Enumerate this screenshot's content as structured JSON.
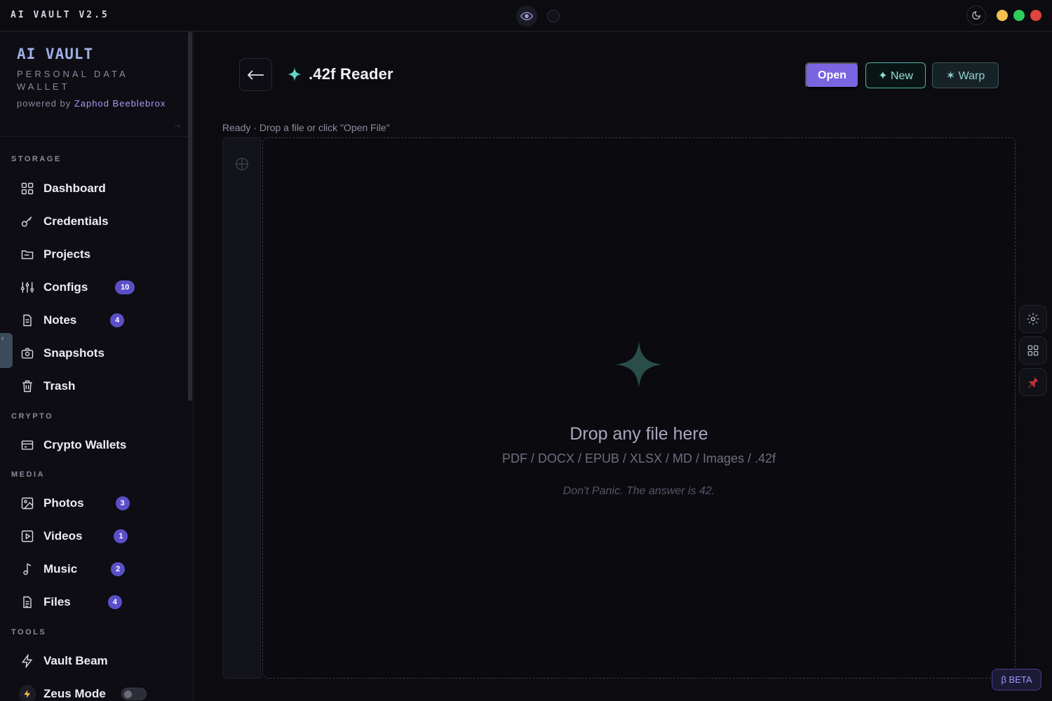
{
  "topbar": {
    "app_title": "AI VAULT V2.5"
  },
  "brand": {
    "title": "AI VAULT",
    "subtitle": "PERSONAL DATA WALLET",
    "powered_prefix": "powered by",
    "author": "Zaphod Beeblebrox"
  },
  "sidebar": {
    "sections": {
      "storage": "STORAGE",
      "crypto": "CRYPTO",
      "media": "MEDIA",
      "tools": "TOOLS"
    },
    "items": [
      {
        "label": "Dashboard",
        "icon": "grid-icon"
      },
      {
        "label": "Credentials",
        "icon": "key-icon"
      },
      {
        "label": "Projects",
        "icon": "folder-icon"
      },
      {
        "label": "Configs",
        "icon": "sliders-icon",
        "badge": "10"
      },
      {
        "label": "Notes",
        "icon": "document-icon",
        "badge": "4"
      },
      {
        "label": "Snapshots",
        "icon": "camera-icon"
      },
      {
        "label": "Trash",
        "icon": "trash-icon"
      },
      {
        "label": "Crypto Wallets",
        "icon": "wallet-icon"
      },
      {
        "label": "Photos",
        "icon": "image-icon",
        "badge": "3"
      },
      {
        "label": "Videos",
        "icon": "video-icon",
        "badge": "1"
      },
      {
        "label": "Music",
        "icon": "music-icon",
        "badge": "2"
      },
      {
        "label": "Files",
        "icon": "file-icon",
        "badge": "4"
      },
      {
        "label": "Vault Beam",
        "icon": "bolt-icon"
      },
      {
        "label": "Zeus Mode",
        "icon": "lightning-icon",
        "toggle": false
      }
    ]
  },
  "main": {
    "title": ".42f Reader",
    "buttons": {
      "open": "Open",
      "new": "✦ New",
      "warp": "✶ Warp"
    },
    "status": "Ready · Drop a file or click \"Open File\"",
    "dropzone": {
      "title": "Drop any file here",
      "formats": "PDF / DOCX / EPUB / XLSX / MD / Images / .42f",
      "tagline": "Don't Panic. The answer is 42."
    }
  },
  "beta_label": "β BETA",
  "colors": {
    "accent": "#7a64e0",
    "teal": "#4fb3a8",
    "badge": "#5a4fc8",
    "traffic_yellow": "#f5bf4f",
    "traffic_green": "#2ecc5a",
    "traffic_red": "#e0443e"
  }
}
